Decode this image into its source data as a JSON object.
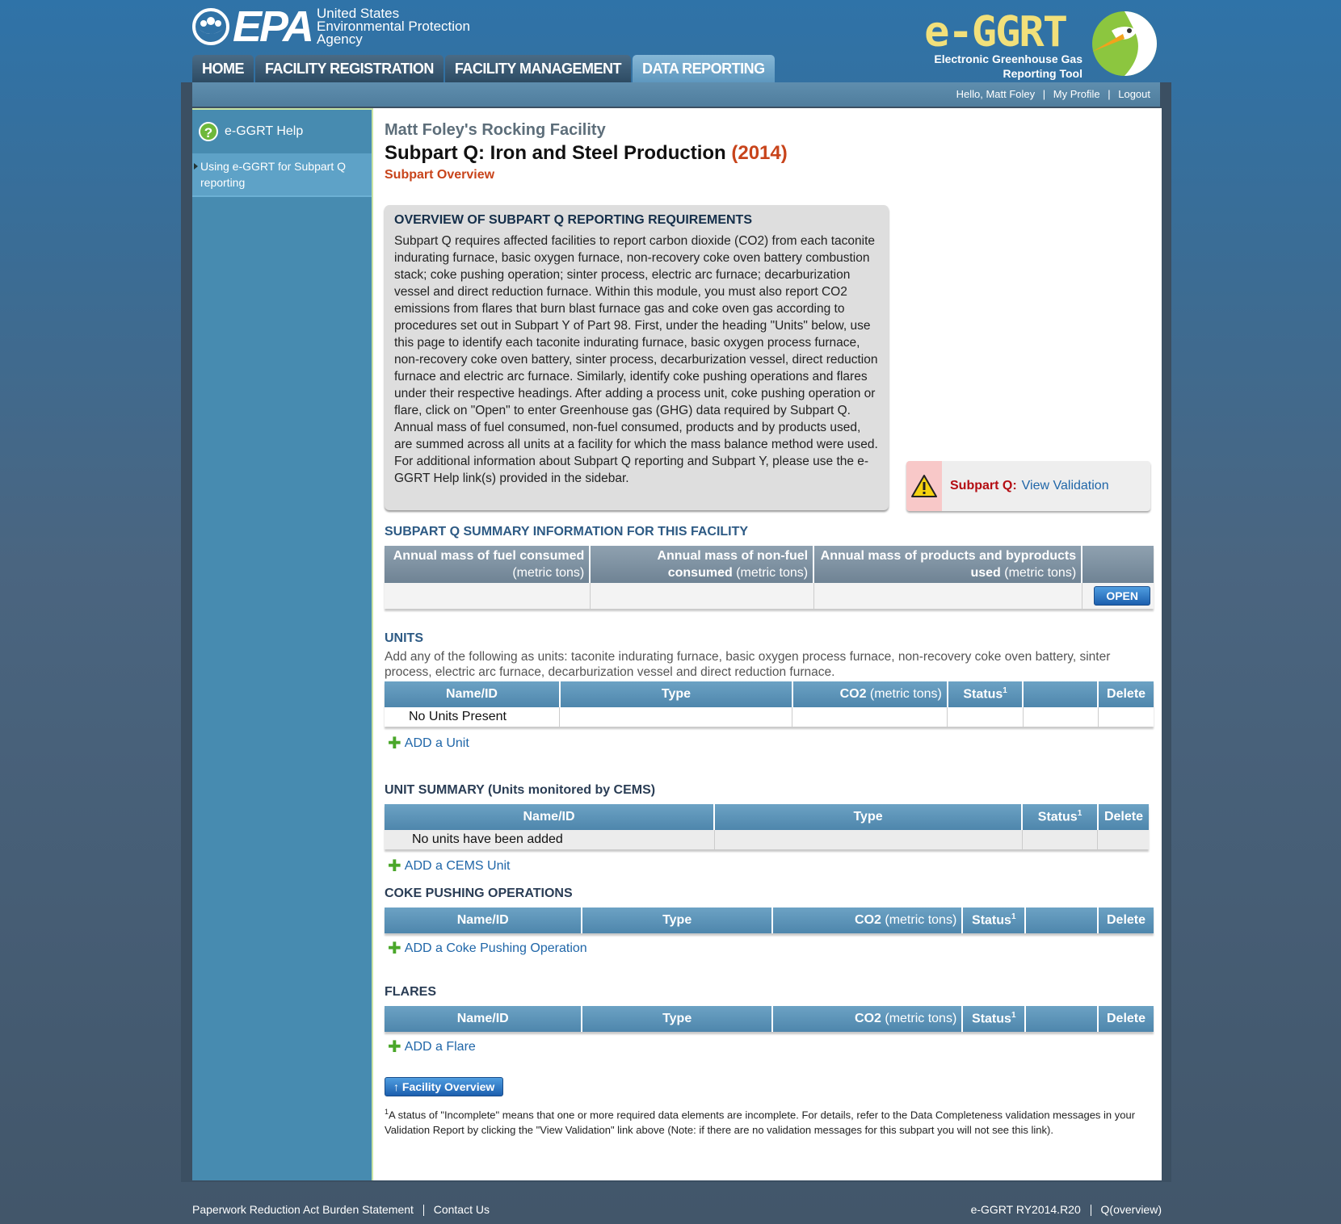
{
  "header": {
    "epa_word": "EPA",
    "epa_agency_lines": [
      "United States",
      "Environmental Protection",
      "Agency"
    ],
    "tool_title": "e-GGRT",
    "tool_subtitle_lines": [
      "Electronic Greenhouse Gas",
      "Reporting Tool"
    ],
    "nav_tabs": [
      {
        "label": "HOME",
        "active": false
      },
      {
        "label": "FACILITY REGISTRATION",
        "active": false
      },
      {
        "label": "FACILITY MANAGEMENT",
        "active": false
      },
      {
        "label": "DATA REPORTING",
        "active": true
      }
    ]
  },
  "userbar": {
    "greeting": "Hello, Matt Foley",
    "profile": "My Profile",
    "logout": "Logout"
  },
  "sidebar": {
    "help_label": "e-GGRT Help",
    "link_label": "Using e-GGRT for Subpart Q reporting"
  },
  "page": {
    "facility_name": "Matt Foley's Rocking Facility",
    "subpart_title": "Subpart Q: Iron and Steel Production",
    "year": "(2014)",
    "subpart_overview": "Subpart Overview"
  },
  "overview": {
    "title": "OVERVIEW OF SUBPART Q REPORTING REQUIREMENTS",
    "text": "Subpart Q requires affected facilities to report carbon dioxide (CO2) from each taconite indurating furnace, basic oxygen furnace, non-recovery coke oven battery combustion stack; coke pushing operation; sinter process, electric arc furnace; decarburization vessel and direct reduction furnace. Within this module, you must also report CO2 emissions from flares that burn blast furnace gas and coke oven gas according to procedures set out in Subpart Y of Part 98. First, under the heading \"Units\" below, use this page to identify each taconite indurating furnace, basic oxygen process furnace, non-recovery coke oven battery, sinter process, decarburization vessel, direct reduction furnace and electric arc furnace. Similarly, identify coke pushing operations and flares under their respective headings. After adding a process unit, coke pushing operation or flare, click on \"Open\" to enter Greenhouse gas (GHG) data required by Subpart Q. Annual mass of fuel consumed, non-fuel consumed, products and by products used, are summed across all units at a facility for which the mass balance method were used. For additional information about Subpart Q reporting and Subpart Y, please use the e-GGRT Help link(s) provided in the sidebar."
  },
  "validation": {
    "label": "Subpart Q:",
    "link": "View Validation"
  },
  "summary": {
    "title": "SUBPART Q SUMMARY INFORMATION FOR THIS FACILITY",
    "col1_bold": "Annual mass of fuel consumed",
    "col1_norm": "(metric tons)",
    "col2_bold_a": "Annual mass of non-fuel",
    "col2_bold_b": "consumed",
    "col2_norm": "(metric tons)",
    "col3_bold_a": "Annual mass of products and byproducts",
    "col3_bold_b": "used",
    "col3_norm": "(metric tons)",
    "open_button": "OPEN"
  },
  "units": {
    "title": "UNITS",
    "description": "Add any of the following as units: taconite indurating furnace, basic oxygen process furnace, non-recovery coke oven battery, sinter process, electric arc furnace, decarburization vessel and direct reduction furnace.",
    "headers": {
      "name": "Name/ID",
      "type": "Type",
      "co2": "CO2",
      "co2_unit": "(metric tons)",
      "status": "Status",
      "status_sup": "1",
      "delete": "Delete"
    },
    "empty_row": "No Units Present",
    "add_link": "ADD a Unit"
  },
  "unit_summary": {
    "title": "UNIT SUMMARY (Units monitored by CEMS)",
    "headers": {
      "name": "Name/ID",
      "type": "Type",
      "status": "Status",
      "status_sup": "1",
      "delete": "Delete"
    },
    "empty_row": "No units have been added",
    "add_link": "ADD a CEMS Unit"
  },
  "coke": {
    "title": "COKE PUSHING OPERATIONS",
    "headers": {
      "name": "Name/ID",
      "type": "Type",
      "co2": "CO2",
      "co2_unit": "(metric tons)",
      "status": "Status",
      "status_sup": "1",
      "delete": "Delete"
    },
    "add_link": "ADD a Coke Pushing Operation"
  },
  "flares": {
    "title": "FLARES",
    "headers": {
      "name": "Name/ID",
      "type": "Type",
      "co2": "CO2",
      "co2_unit": "(metric tons)",
      "status": "Status",
      "status_sup": "1",
      "delete": "Delete"
    },
    "add_link": "ADD a Flare"
  },
  "facility_overview_button": "Facility Overview",
  "footnote": {
    "sup": "1",
    "text": "A status of \"Incomplete\" means that one or more required data elements are incomplete. For details, refer to the Data Completeness validation messages in your Validation Report by clicking the \"View Validation\" link above (Note: if there are no validation messages for this subpart you will not see this link)."
  },
  "footer": {
    "paperwork": "Paperwork Reduction Act Burden Statement",
    "contact": "Contact Us",
    "version": "e-GGRT RY2014.R20",
    "page_id": "Q(overview)"
  }
}
